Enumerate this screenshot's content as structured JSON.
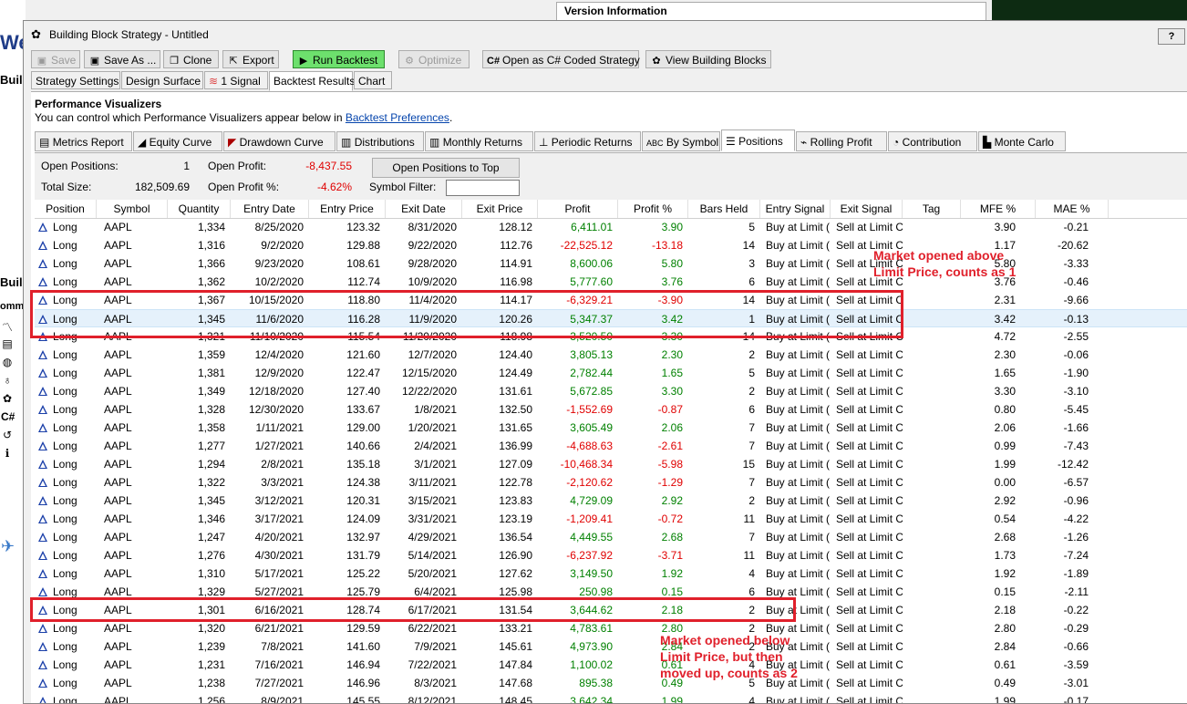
{
  "background": {
    "left_header": "We",
    "left_labels": [
      "Buil",
      "Buil",
      "omm"
    ],
    "version_info": "Version Information"
  },
  "window": {
    "title": "Building Block Strategy - Untitled",
    "help": "?"
  },
  "toolbar": {
    "save": "Save",
    "save_as": "Save As ...",
    "clone": "Clone",
    "export": "Export",
    "run_backtest": "Run Backtest",
    "optimize": "Optimize",
    "open_csharp": "Open as C# Coded Strategy",
    "view_blocks": "View Building Blocks"
  },
  "main_tabs": [
    "Strategy Settings",
    "Design Surface",
    "1 Signal",
    "Backtest Results",
    "Chart"
  ],
  "visualizers": {
    "title": "Performance Visualizers",
    "subtitle": "You can control which Performance Visualizers appear below in",
    "link": "Backtest Preferences",
    "period": ".",
    "tabs": [
      "Metrics Report",
      "Equity Curve",
      "Drawdown Curve",
      "Distributions",
      "Monthly Returns",
      "Periodic Returns",
      "By Symbol",
      "Positions",
      "Rolling Profit",
      "Contribution",
      "Monte Carlo"
    ]
  },
  "summary": {
    "open_positions_label": "Open Positions:",
    "open_positions_value": "1",
    "open_profit_label": "Open Profit:",
    "open_profit_value": "-8,437.55",
    "total_size_label": "Total Size:",
    "total_size_value": "182,509.69",
    "open_profit_pct_label": "Open Profit %:",
    "open_profit_pct_value": "-4.62%",
    "open_to_top_button": "Open Positions to Top",
    "symbol_filter_label": "Symbol Filter:"
  },
  "columns": [
    "Position",
    "Symbol",
    "Quantity",
    "Entry Date",
    "Entry Price",
    "Exit Date",
    "Exit Price",
    "Profit",
    "Profit %",
    "Bars Held",
    "Entry Signal",
    "Exit Signal",
    "Tag",
    "MFE %",
    "MAE %"
  ],
  "rows": [
    [
      "Long",
      "AAPL",
      "1,334",
      "8/25/2020",
      "123.32",
      "8/31/2020",
      "128.12",
      "6,411.01",
      "3.90",
      "5",
      "Buy at Limit (",
      "Sell at Limit C",
      "",
      "3.90",
      "-0.21"
    ],
    [
      "Long",
      "AAPL",
      "1,316",
      "9/2/2020",
      "129.88",
      "9/22/2020",
      "112.76",
      "-22,525.12",
      "-13.18",
      "14",
      "Buy at Limit (",
      "Sell at Limit C",
      "",
      "1.17",
      "-20.62"
    ],
    [
      "Long",
      "AAPL",
      "1,366",
      "9/23/2020",
      "108.61",
      "9/28/2020",
      "114.91",
      "8,600.06",
      "5.80",
      "3",
      "Buy at Limit (",
      "Sell at Limit C",
      "",
      "5.80",
      "-3.33"
    ],
    [
      "Long",
      "AAPL",
      "1,362",
      "10/2/2020",
      "112.74",
      "10/9/2020",
      "116.98",
      "5,777.60",
      "3.76",
      "6",
      "Buy at Limit (",
      "Sell at Limit C",
      "",
      "3.76",
      "-0.46"
    ],
    [
      "Long",
      "AAPL",
      "1,367",
      "10/15/2020",
      "118.80",
      "11/4/2020",
      "114.17",
      "-6,329.21",
      "-3.90",
      "14",
      "Buy at Limit (",
      "Sell at Limit C",
      "",
      "2.31",
      "-9.66"
    ],
    [
      "Long",
      "AAPL",
      "1,345",
      "11/6/2020",
      "116.28",
      "11/9/2020",
      "120.26",
      "5,347.37",
      "3.42",
      "1",
      "Buy at Limit (",
      "Sell at Limit C",
      "",
      "3.42",
      "-0.13"
    ],
    [
      "Long",
      "AAPL",
      "1,321",
      "11/10/2020",
      "115.54",
      "11/20/2020",
      "118.98",
      "3,520.50",
      "3.30",
      "14",
      "Buy at Limit (",
      "Sell at Limit C",
      "",
      "4.72",
      "-2.55"
    ],
    [
      "Long",
      "AAPL",
      "1,359",
      "12/4/2020",
      "121.60",
      "12/7/2020",
      "124.40",
      "3,805.13",
      "2.30",
      "2",
      "Buy at Limit (",
      "Sell at Limit C",
      "",
      "2.30",
      "-0.06"
    ],
    [
      "Long",
      "AAPL",
      "1,381",
      "12/9/2020",
      "122.47",
      "12/15/2020",
      "124.49",
      "2,782.44",
      "1.65",
      "5",
      "Buy at Limit (",
      "Sell at Limit C",
      "",
      "1.65",
      "-1.90"
    ],
    [
      "Long",
      "AAPL",
      "1,349",
      "12/18/2020",
      "127.40",
      "12/22/2020",
      "131.61",
      "5,672.85",
      "3.30",
      "2",
      "Buy at Limit (",
      "Sell at Limit C",
      "",
      "3.30",
      "-3.10"
    ],
    [
      "Long",
      "AAPL",
      "1,328",
      "12/30/2020",
      "133.67",
      "1/8/2021",
      "132.50",
      "-1,552.69",
      "-0.87",
      "6",
      "Buy at Limit (",
      "Sell at Limit C",
      "",
      "0.80",
      "-5.45"
    ],
    [
      "Long",
      "AAPL",
      "1,358",
      "1/11/2021",
      "129.00",
      "1/20/2021",
      "131.65",
      "3,605.49",
      "2.06",
      "7",
      "Buy at Limit (",
      "Sell at Limit C",
      "",
      "2.06",
      "-1.66"
    ],
    [
      "Long",
      "AAPL",
      "1,277",
      "1/27/2021",
      "140.66",
      "2/4/2021",
      "136.99",
      "-4,688.63",
      "-2.61",
      "7",
      "Buy at Limit (",
      "Sell at Limit C",
      "",
      "0.99",
      "-7.43"
    ],
    [
      "Long",
      "AAPL",
      "1,294",
      "2/8/2021",
      "135.18",
      "3/1/2021",
      "127.09",
      "-10,468.34",
      "-5.98",
      "15",
      "Buy at Limit (",
      "Sell at Limit C",
      "",
      "1.99",
      "-12.42"
    ],
    [
      "Long",
      "AAPL",
      "1,322",
      "3/3/2021",
      "124.38",
      "3/11/2021",
      "122.78",
      "-2,120.62",
      "-1.29",
      "7",
      "Buy at Limit (",
      "Sell at Limit C",
      "",
      "0.00",
      "-6.57"
    ],
    [
      "Long",
      "AAPL",
      "1,345",
      "3/12/2021",
      "120.31",
      "3/15/2021",
      "123.83",
      "4,729.09",
      "2.92",
      "2",
      "Buy at Limit (",
      "Sell at Limit C",
      "",
      "2.92",
      "-0.96"
    ],
    [
      "Long",
      "AAPL",
      "1,346",
      "3/17/2021",
      "124.09",
      "3/31/2021",
      "123.19",
      "-1,209.41",
      "-0.72",
      "11",
      "Buy at Limit (",
      "Sell at Limit C",
      "",
      "0.54",
      "-4.22"
    ],
    [
      "Long",
      "AAPL",
      "1,247",
      "4/20/2021",
      "132.97",
      "4/29/2021",
      "136.54",
      "4,449.55",
      "2.68",
      "7",
      "Buy at Limit (",
      "Sell at Limit C",
      "",
      "2.68",
      "-1.26"
    ],
    [
      "Long",
      "AAPL",
      "1,276",
      "4/30/2021",
      "131.79",
      "5/14/2021",
      "126.90",
      "-6,237.92",
      "-3.71",
      "11",
      "Buy at Limit (",
      "Sell at Limit C",
      "",
      "1.73",
      "-7.24"
    ],
    [
      "Long",
      "AAPL",
      "1,310",
      "5/17/2021",
      "125.22",
      "5/20/2021",
      "127.62",
      "3,149.50",
      "1.92",
      "4",
      "Buy at Limit (",
      "Sell at Limit C",
      "",
      "1.92",
      "-1.89"
    ],
    [
      "Long",
      "AAPL",
      "1,329",
      "5/27/2021",
      "125.79",
      "6/4/2021",
      "125.98",
      "250.98",
      "0.15",
      "6",
      "Buy at Limit (",
      "Sell at Limit C",
      "",
      "0.15",
      "-2.11"
    ],
    [
      "Long",
      "AAPL",
      "1,301",
      "6/16/2021",
      "128.74",
      "6/17/2021",
      "131.54",
      "3,644.62",
      "2.18",
      "2",
      "Buy at Limit (",
      "Sell at Limit C",
      "",
      "2.18",
      "-0.22"
    ],
    [
      "Long",
      "AAPL",
      "1,320",
      "6/21/2021",
      "129.59",
      "6/22/2021",
      "133.21",
      "4,783.61",
      "2.80",
      "2",
      "Buy at Limit (",
      "Sell at Limit C",
      "",
      "2.80",
      "-0.29"
    ],
    [
      "Long",
      "AAPL",
      "1,239",
      "7/8/2021",
      "141.60",
      "7/9/2021",
      "145.61",
      "4,973.90",
      "2.84",
      "2",
      "Buy at Limit (",
      "Sell at Limit C",
      "",
      "2.84",
      "-0.66"
    ],
    [
      "Long",
      "AAPL",
      "1,231",
      "7/16/2021",
      "146.94",
      "7/22/2021",
      "147.84",
      "1,100.02",
      "0.61",
      "4",
      "Buy at Limit (",
      "Sell at Limit C",
      "",
      "0.61",
      "-3.59"
    ],
    [
      "Long",
      "AAPL",
      "1,238",
      "7/27/2021",
      "146.96",
      "8/3/2021",
      "147.68",
      "895.38",
      "0.49",
      "5",
      "Buy at Limit (",
      "Sell at Limit C",
      "",
      "0.49",
      "-3.01"
    ],
    [
      "Long",
      "AAPL",
      "1,256",
      "8/9/2021",
      "145.55",
      "8/12/2021",
      "148.45",
      "3,642.34",
      "1.99",
      "4",
      "Buy at Limit (",
      "Sell at Limit C",
      "",
      "1.99",
      "-0.17"
    ]
  ],
  "annotations": {
    "note1": [
      "Market opened above",
      "Limit Price, counts as 1"
    ],
    "note2": [
      "Market opened below",
      "Limit Price, but then",
      "moved up, counts as 2"
    ]
  },
  "colors": {
    "negative": "#e00000",
    "positive": "#008000",
    "annotation": "#e0202b",
    "run_button": "#6de06d"
  }
}
